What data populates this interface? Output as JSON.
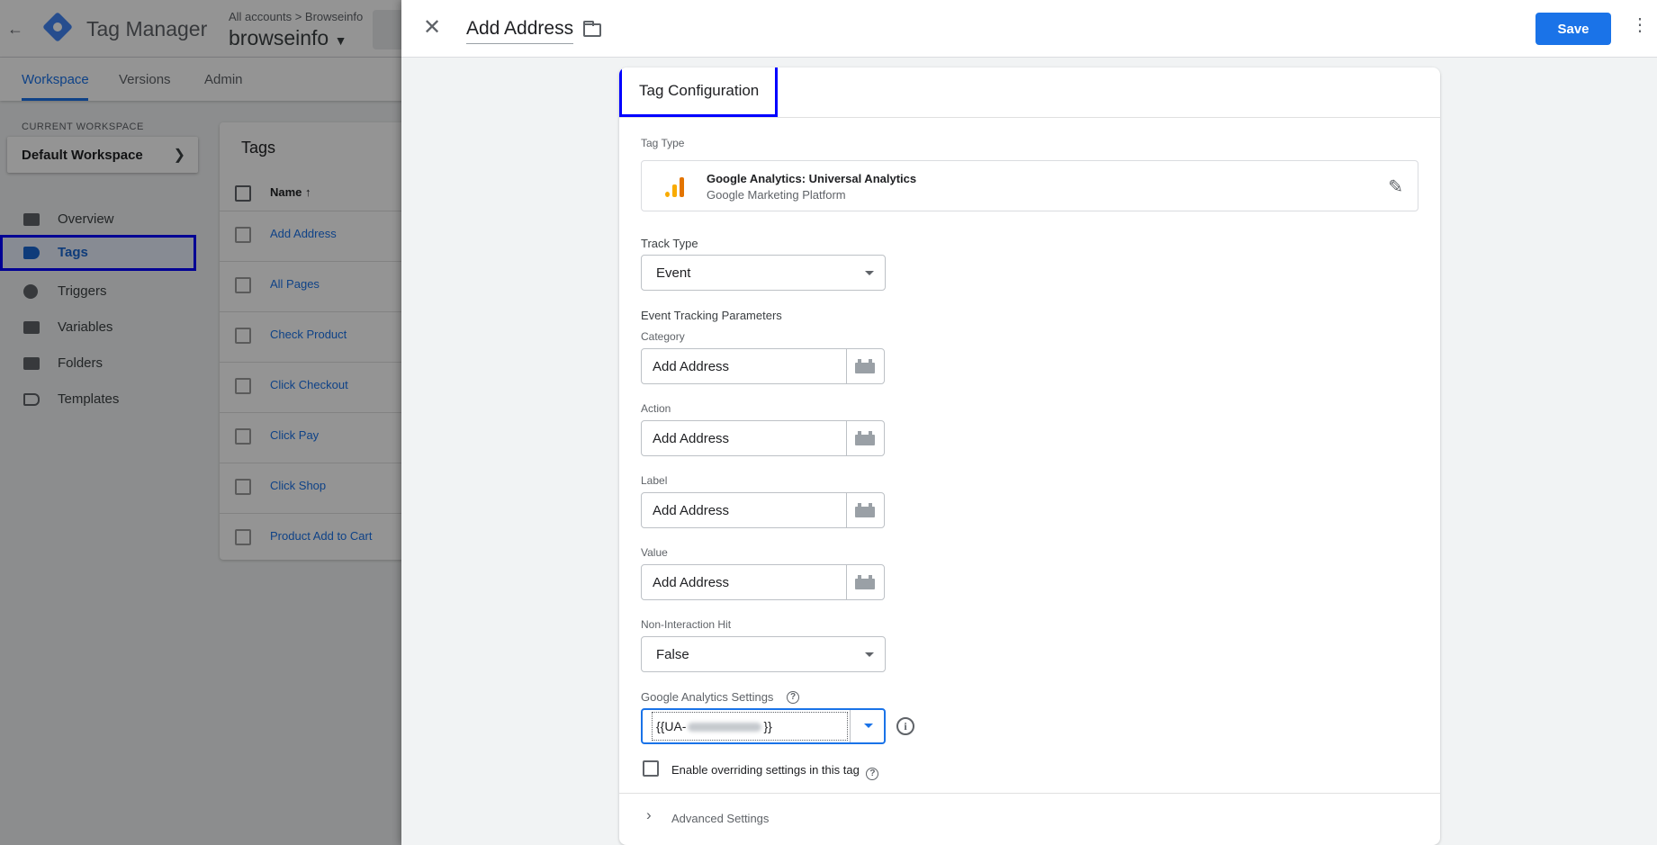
{
  "app": {
    "title": "Tag Manager",
    "breadcrumb": "All accounts > Browseinfo",
    "container": "browseinfo"
  },
  "nav": {
    "tabs": [
      {
        "label": "Workspace",
        "active": true
      },
      {
        "label": "Versions",
        "active": false
      },
      {
        "label": "Admin",
        "active": false
      }
    ]
  },
  "sidebar": {
    "workspace_label": "CURRENT WORKSPACE",
    "workspace_name": "Default Workspace",
    "items": [
      {
        "label": "Overview",
        "icon": "briefcase-icon"
      },
      {
        "label": "Tags",
        "icon": "tag-icon",
        "selected": true
      },
      {
        "label": "Triggers",
        "icon": "trigger-icon"
      },
      {
        "label": "Variables",
        "icon": "variables-icon"
      },
      {
        "label": "Folders",
        "icon": "folder-icon"
      },
      {
        "label": "Templates",
        "icon": "template-icon"
      }
    ]
  },
  "tags_list": {
    "title": "Tags",
    "column_name": "Name ↑",
    "rows": [
      "Add Address",
      "All Pages",
      "Check Product",
      "Click Checkout",
      "Click Pay",
      "Click Shop",
      "Product Add to Cart"
    ]
  },
  "panel": {
    "title": "Add Address",
    "save_label": "Save",
    "config_title": "Tag Configuration",
    "tag_type_label": "Tag Type",
    "tag_type_name": "Google Analytics: Universal Analytics",
    "tag_type_sub": "Google Marketing Platform",
    "track_type_label": "Track Type",
    "track_type_value": "Event",
    "event_params_label": "Event Tracking Parameters",
    "category_label": "Category",
    "category_value": "Add Address",
    "action_label": "Action",
    "action_value": "Add Address",
    "label_label": "Label",
    "label_value": "Add Address",
    "value_label": "Value",
    "value_value": "Add Address",
    "non_interaction_label": "Non-Interaction Hit",
    "non_interaction_value": "False",
    "ga_settings_label": "Google Analytics Settings",
    "ga_settings_prefix": "{{UA-",
    "ga_settings_suffix": "}}",
    "override_label": "Enable overriding settings in this tag",
    "advanced_label": "Advanced Settings"
  },
  "colors": {
    "accent": "#1a73e8",
    "highlight_box": "#0000ff",
    "ga_orange": "#f9ab00"
  }
}
